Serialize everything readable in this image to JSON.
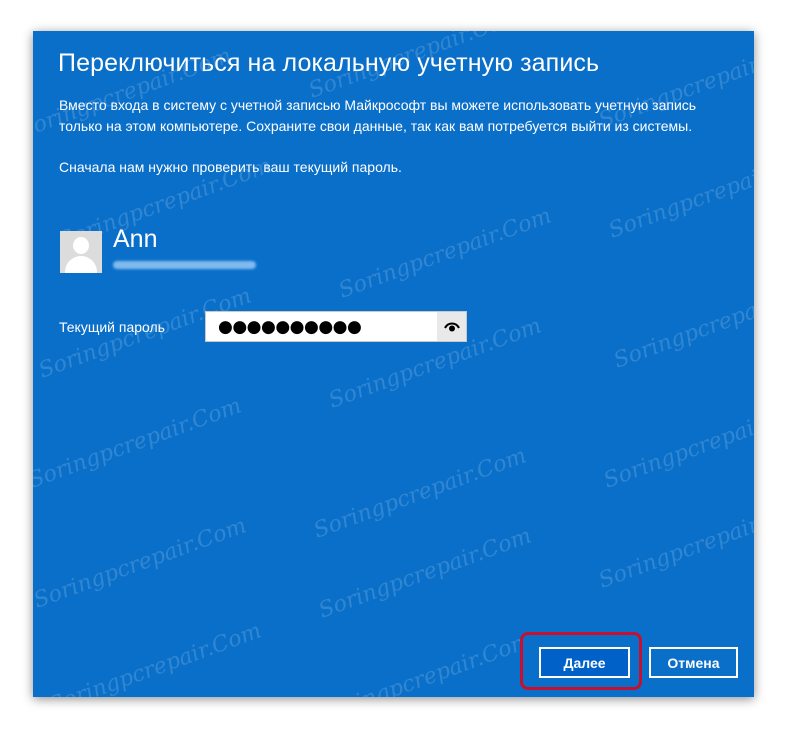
{
  "dialog": {
    "title": "Переключиться на локальную учетную запись",
    "description": "Вместо входа в систему с учетной записью Майкрософт вы можете использовать учетную запись только на этом компьютере. Сохраните свои данные, так как вам потребуется выйти из системы.",
    "instruction": "Сначала нам нужно проверить ваш текущий пароль."
  },
  "user": {
    "name": "Ann"
  },
  "password": {
    "label": "Текущий пароль",
    "masked_value": "●●●●●●●●●●"
  },
  "buttons": {
    "next": "Далее",
    "cancel": "Отмена"
  },
  "watermark": "Soringpcrepair.Com",
  "colors": {
    "dialog_bg": "#0a6fc9",
    "highlight": "#c8102e"
  },
  "icons": {
    "avatar": "user-avatar-icon",
    "reveal": "eye-icon"
  }
}
